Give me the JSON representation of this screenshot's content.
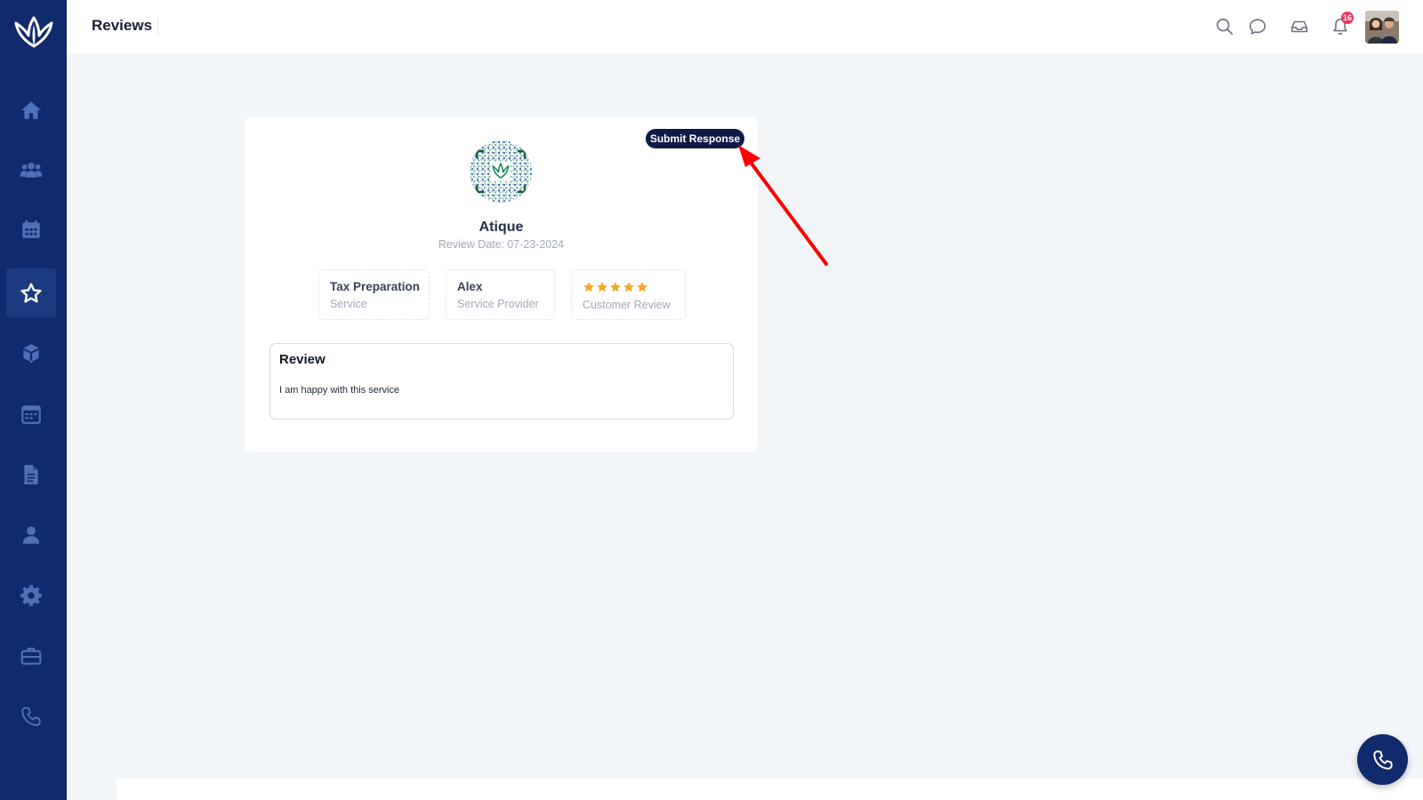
{
  "header": {
    "title": "Reviews",
    "notification_count": "16"
  },
  "sidebar": {
    "items": [
      {
        "icon": "home-icon",
        "label": "Home"
      },
      {
        "icon": "users-icon",
        "label": "Clients"
      },
      {
        "icon": "calendar-icon",
        "label": "Calendar"
      },
      {
        "icon": "star-icon",
        "label": "Reviews",
        "active": true
      },
      {
        "icon": "box-icon",
        "label": "Packages"
      },
      {
        "icon": "schedule-icon",
        "label": "Schedule"
      },
      {
        "icon": "document-icon",
        "label": "Documents"
      },
      {
        "icon": "user-icon",
        "label": "Profile"
      },
      {
        "icon": "gear-icon",
        "label": "Settings"
      },
      {
        "icon": "briefcase-icon",
        "label": "Services"
      },
      {
        "icon": "phone-icon",
        "label": "Calls"
      }
    ]
  },
  "review": {
    "submit_label": "Submit Response",
    "reviewer_name": "Atique",
    "date_label": "Review Date:",
    "date_value": "07-23-2024",
    "service": {
      "value": "Tax Preparation",
      "label": "Service"
    },
    "provider": {
      "value": "Alex",
      "label": "Service Provider"
    },
    "rating": {
      "value": 5,
      "max": 5,
      "label": "Customer Review"
    },
    "heading": "Review",
    "text": "I am happy with this service"
  },
  "colors": {
    "sidebar": "#102a6b",
    "accent_dark": "#0e1b47",
    "star": "#f5a623",
    "badge": "#f0325f",
    "annotation": "#ff0000"
  }
}
